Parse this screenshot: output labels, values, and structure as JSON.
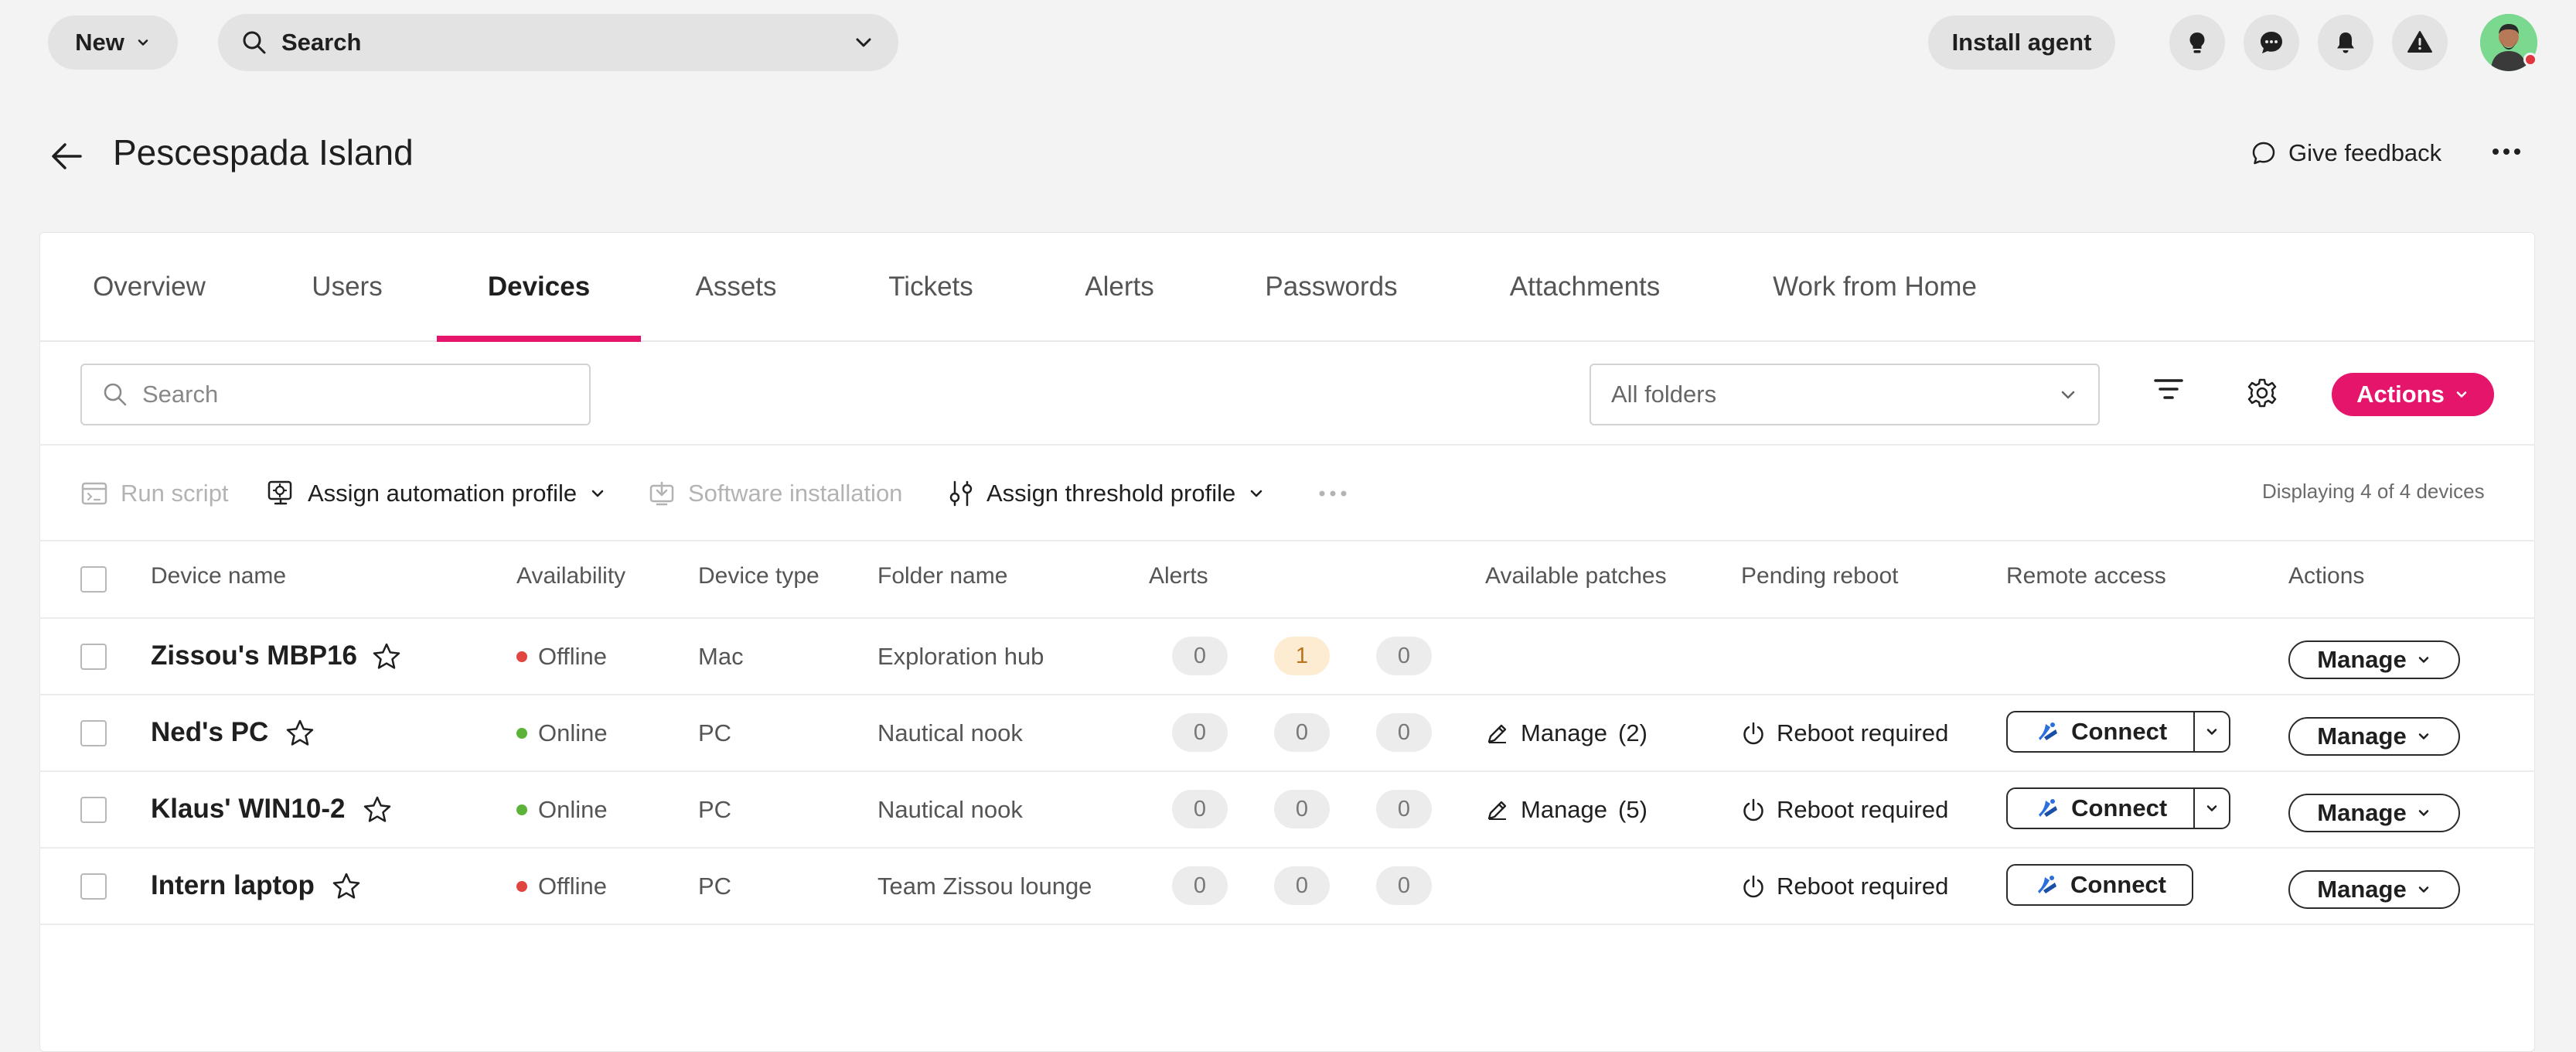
{
  "topbar": {
    "new_label": "New",
    "search_label": "Search",
    "install_label": "Install agent",
    "icons": [
      "lightbulb-icon",
      "chat-icon",
      "bell-icon",
      "warning-icon"
    ]
  },
  "page": {
    "title": "Pescespada Island",
    "feedback_label": "Give feedback"
  },
  "tabs": [
    {
      "label": "Overview",
      "active": false
    },
    {
      "label": "Users",
      "active": false
    },
    {
      "label": "Devices",
      "active": true
    },
    {
      "label": "Assets",
      "active": false
    },
    {
      "label": "Tickets",
      "active": false
    },
    {
      "label": "Alerts",
      "active": false
    },
    {
      "label": "Passwords",
      "active": false
    },
    {
      "label": "Attachments",
      "active": false
    },
    {
      "label": "Work from Home",
      "active": false
    }
  ],
  "filters": {
    "search_placeholder": "Search",
    "folder_value": "All folders",
    "actions_label": "Actions"
  },
  "toolbar": {
    "run_script": "Run script",
    "assign_automation": "Assign automation profile",
    "software_install": "Software installation",
    "assign_threshold": "Assign threshold profile",
    "displaying": "Displaying 4 of 4 devices"
  },
  "table": {
    "headers": {
      "device_name": "Device name",
      "availability": "Availability",
      "device_type": "Device type",
      "folder_name": "Folder name",
      "alerts": "Alerts",
      "patches": "Available patches",
      "reboot": "Pending reboot",
      "remote": "Remote access",
      "actions": "Actions"
    },
    "rows": [
      {
        "name": "Zissou's MBP16",
        "availability": "Offline",
        "type": "Mac",
        "folder": "Exploration hub",
        "alerts": [
          "0",
          "1",
          "0"
        ],
        "patches": "",
        "patches_count": "",
        "reboot": "",
        "connect": "",
        "manage": "Manage"
      },
      {
        "name": "Ned's PC",
        "availability": "Online",
        "type": "PC",
        "folder": "Nautical nook",
        "alerts": [
          "0",
          "0",
          "0"
        ],
        "patches": "Manage",
        "patches_count": "(2)",
        "reboot": "Reboot required",
        "connect": "Connect",
        "manage": "Manage"
      },
      {
        "name": "Klaus' WIN10-2",
        "availability": "Online",
        "type": "PC",
        "folder": "Nautical nook",
        "alerts": [
          "0",
          "0",
          "0"
        ],
        "patches": "Manage",
        "patches_count": "(5)",
        "reboot": "Reboot required",
        "connect": "Connect",
        "manage": "Manage"
      },
      {
        "name": "Intern laptop",
        "availability": "Offline",
        "type": "PC",
        "folder": "Team Zissou lounge",
        "alerts": [
          "0",
          "0",
          "0"
        ],
        "patches": "",
        "patches_count": "",
        "reboot": "Reboot required",
        "connect": "Connect",
        "manage": "Manage"
      }
    ]
  },
  "colors": {
    "accent": "#e5156b",
    "online": "#5db33a",
    "offline": "#e2443f",
    "alert_warn_bg": "#fdebd2",
    "alert_warn_fg": "#b9741d",
    "connect_icon": "#2a6fdb"
  }
}
